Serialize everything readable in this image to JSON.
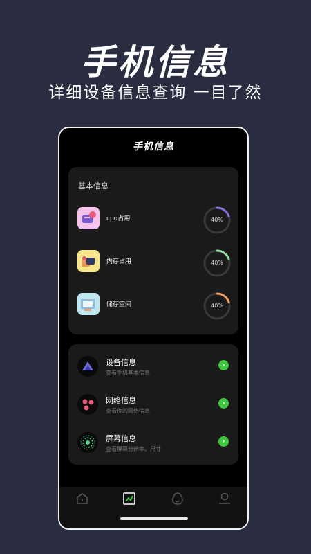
{
  "promo": {
    "title": "手机信息",
    "subtitle": "详细设备信息查询 一目了然"
  },
  "app": {
    "title": "手机信息"
  },
  "basic": {
    "title": "基本信息",
    "stats": [
      {
        "label": "cpu占用",
        "percent": 40,
        "percent_text": "40%",
        "color": "#8b6fd8",
        "icon": "cpu-chip-icon"
      },
      {
        "label": "内存占用",
        "percent": 40,
        "percent_text": "40%",
        "color": "#8fd8a0",
        "icon": "memory-icon"
      },
      {
        "label": "储存空间",
        "percent": 40,
        "percent_text": "40%",
        "color": "#f0a060",
        "icon": "storage-icon"
      }
    ]
  },
  "menu": {
    "items": [
      {
        "label": "设备信息",
        "desc": "查看手机基本信息",
        "icon": "device-icon"
      },
      {
        "label": "网络信息",
        "desc": "查看你的网络信息",
        "icon": "network-icon"
      },
      {
        "label": "屏幕信息",
        "desc": "查看屏幕分辨率、尺寸",
        "icon": "screen-icon"
      }
    ]
  },
  "tabbar": {
    "tabs": [
      {
        "icon": "home-icon",
        "active": false
      },
      {
        "icon": "chart-icon",
        "active": true
      },
      {
        "icon": "egg-icon",
        "active": false
      },
      {
        "icon": "profile-icon",
        "active": false
      }
    ]
  },
  "colors": {
    "background": "#2a2c40",
    "card": "#1a1a1a",
    "accent_green": "#3fc63f"
  }
}
